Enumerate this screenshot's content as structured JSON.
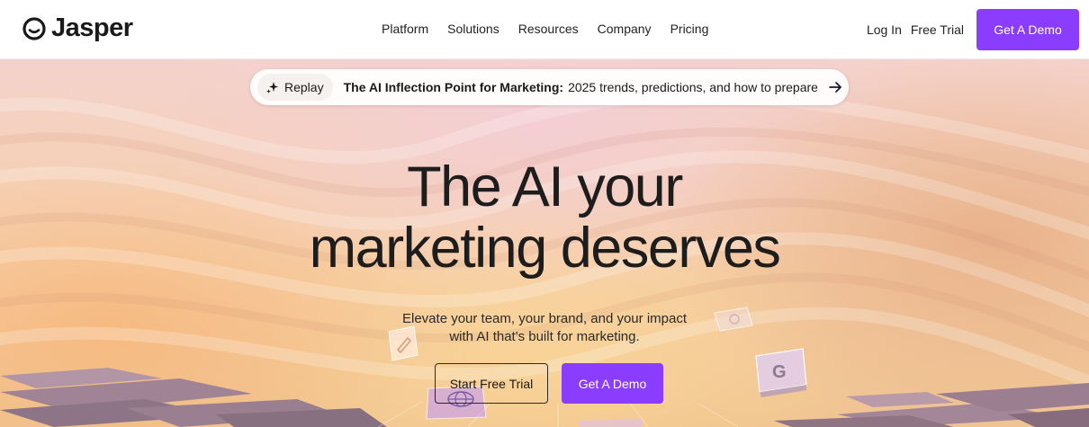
{
  "brand": {
    "name": "Jasper",
    "accent": "#8b3dff"
  },
  "nav": {
    "menu": [
      "Platform",
      "Solutions",
      "Resources",
      "Company",
      "Pricing"
    ],
    "login": "Log In",
    "free_trial": "Free Trial",
    "demo": "Get A Demo"
  },
  "announcement": {
    "tag_icon": "sparkle-icon",
    "tag": "Replay",
    "bold": "The AI Inflection Point for Marketing:",
    "rest": "2025 trends, predictions, and how to prepare",
    "arrow_icon": "arrow-right-icon"
  },
  "hero": {
    "headline_line1": "The AI your",
    "headline_line2": "marketing deserves",
    "sub_line1": "Elevate your team, your brand, and your impact",
    "sub_line2": "with AI that's built for marketing.",
    "cta_trial": "Start Free Trial",
    "cta_demo": "Get A Demo"
  },
  "decor": {
    "tile_letter": "G",
    "tiles": [
      "pencil-tile-icon",
      "google-tile-icon",
      "cube-tile-icon",
      "globe-tile-icon"
    ]
  }
}
